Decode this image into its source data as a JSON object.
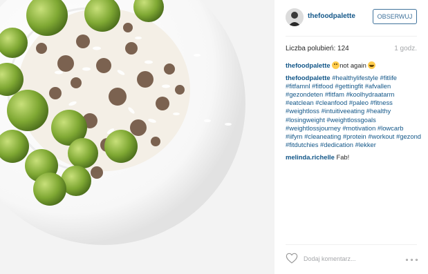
{
  "post": {
    "image_alt": "Plate of rice with minced meat and brussels sprouts",
    "icons": {
      "avatar": "avatar",
      "heart": "heart-icon",
      "more": "more-options-icon"
    }
  },
  "header": {
    "username": "thefoodpalette",
    "follow_label": "OBSERWUJ"
  },
  "stats": {
    "likes": "Liczba polubień: 124",
    "time": "1 godz."
  },
  "caption": {
    "user": "thefoodpalette",
    "text": "not again",
    "emojis": [
      "weary-face",
      "grinning-face"
    ]
  },
  "hashtag_comment": {
    "user": "thefoodpalette",
    "tags": [
      "#healthylifestyle",
      "#fitlife",
      "#fitfamnl",
      "#fitfood",
      "#gettingfit",
      "#afvallen",
      "#gezondeten",
      "#fitfam",
      "#koolhydraatarm",
      "#eatclean",
      "#cleanfood",
      "#paleo",
      "#fitness",
      "#weightloss",
      "#intuitiveeating",
      "#healthy",
      "#losingweight",
      "#weightlossgoals",
      "#weightlossjourney",
      "#motivation",
      "#lowcarb",
      "#iifym",
      "#cleaneating",
      "#protein",
      "#workout",
      "#gezond",
      "#fitdutchies",
      "#dedication",
      "#lekker"
    ]
  },
  "reply": {
    "user": "melinda.richelle",
    "text": "Fab!"
  },
  "footer": {
    "comment_placeholder": "Dodaj komentarz..."
  },
  "colors": {
    "link": "#125688",
    "follow": "#3f729b",
    "muted": "#a5a7aa"
  }
}
